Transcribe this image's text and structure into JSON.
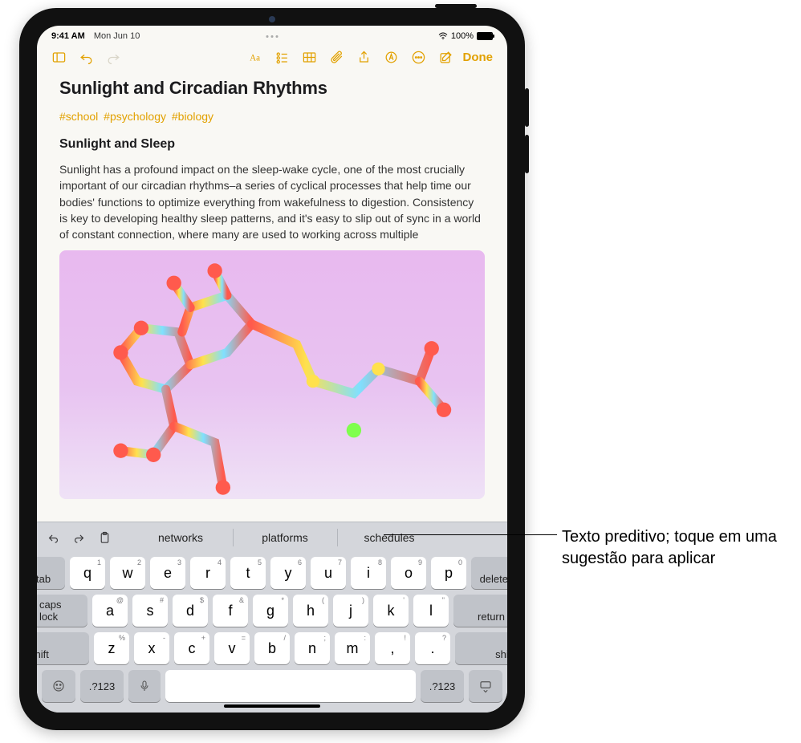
{
  "status": {
    "time": "9:41 AM",
    "date": "Mon Jun 10",
    "battery_pct": "100%"
  },
  "toolbar": {
    "done": "Done"
  },
  "note": {
    "title": "Sunlight and Circadian Rhythms",
    "tags": [
      "#school",
      "#psychology",
      "#biology"
    ],
    "heading": "Sunlight and Sleep",
    "body": "Sunlight has a profound impact on the sleep-wake cycle, one of the most crucially important of our circadian rhythms–a series of cyclical processes that help time our bodies' functions to optimize everything from wakefulness to digestion. Consistency is key to developing healthy sleep patterns, and it's easy to slip out of sync in a world of constant connection, where many are used to working across multiple"
  },
  "predictive": {
    "suggestions": [
      "networks",
      "platforms",
      "schedules"
    ]
  },
  "keyboard": {
    "row1": [
      {
        "k": "q",
        "h": "1"
      },
      {
        "k": "w",
        "h": "2"
      },
      {
        "k": "e",
        "h": "3"
      },
      {
        "k": "r",
        "h": "4"
      },
      {
        "k": "t",
        "h": "5"
      },
      {
        "k": "y",
        "h": "6"
      },
      {
        "k": "u",
        "h": "7"
      },
      {
        "k": "i",
        "h": "8"
      },
      {
        "k": "o",
        "h": "9"
      },
      {
        "k": "p",
        "h": "0"
      }
    ],
    "row2": [
      {
        "k": "a",
        "h": "@"
      },
      {
        "k": "s",
        "h": "#"
      },
      {
        "k": "d",
        "h": "$"
      },
      {
        "k": "f",
        "h": "&"
      },
      {
        "k": "g",
        "h": "*"
      },
      {
        "k": "h",
        "h": "("
      },
      {
        "k": "j",
        "h": ")"
      },
      {
        "k": "k",
        "h": "'"
      },
      {
        "k": "l",
        "h": "\""
      }
    ],
    "row3": [
      {
        "k": "z",
        "h": "%"
      },
      {
        "k": "x",
        "h": "-"
      },
      {
        "k": "c",
        "h": "+"
      },
      {
        "k": "v",
        "h": "="
      },
      {
        "k": "b",
        "h": "/"
      },
      {
        "k": "n",
        "h": ";"
      },
      {
        "k": "m",
        "h": ":"
      },
      {
        "k": ",",
        "h": "!"
      },
      {
        "k": ".",
        "h": "?"
      }
    ],
    "tab": "tab",
    "delete": "delete",
    "caps": "caps lock",
    "return": "return",
    "shift": "shift",
    "sym": ".?123"
  },
  "callout": {
    "text": "Texto preditivo; toque em uma sugestão para aplicar"
  }
}
